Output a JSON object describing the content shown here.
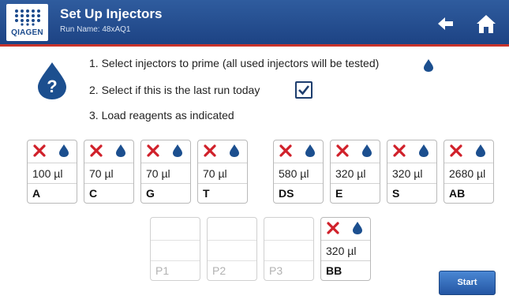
{
  "header": {
    "logo_text": "QIAGEN",
    "title": "Set Up Injectors",
    "subtitle": "Run Name: 48xAQ1",
    "colors": {
      "bar": "#1d4384",
      "accent_line": "#c8332b"
    },
    "icons": [
      "back-arrow-icon",
      "home-icon"
    ]
  },
  "instructions": {
    "step1": "1. Select injectors to prime (all used injectors will be tested)",
    "step2": "2. Select if this is the last run today",
    "step3": "3. Load reagents as indicated",
    "last_run_today_checked": true,
    "icons": [
      "reagent-drop-help-icon",
      "drop-icon",
      "checkmark-icon"
    ]
  },
  "injectors_row1": [
    {
      "volume": "100 µl",
      "label": "A"
    },
    {
      "volume": "70 µl",
      "label": "C"
    },
    {
      "volume": "70 µl",
      "label": "G"
    },
    {
      "volume": "70 µl",
      "label": "T"
    },
    {
      "volume": "580 µl",
      "label": "DS"
    },
    {
      "volume": "320 µl",
      "label": "E"
    },
    {
      "volume": "320 µl",
      "label": "S"
    },
    {
      "volume": "2680 µl",
      "label": "AB"
    }
  ],
  "injectors_row2": [
    {
      "volume": "",
      "label": "P1",
      "enabled": false
    },
    {
      "volume": "",
      "label": "P2",
      "enabled": false
    },
    {
      "volume": "",
      "label": "P3",
      "enabled": false
    },
    {
      "volume": "320 µl",
      "label": "BB",
      "enabled": true
    }
  ],
  "injector_icons": [
    "not-primed-x-icon",
    "drop-icon"
  ],
  "colors": {
    "x_mark": "#d0202a",
    "drop": "#1c4f8f",
    "start_button": "#2a5ba7"
  },
  "start_label": "Start"
}
